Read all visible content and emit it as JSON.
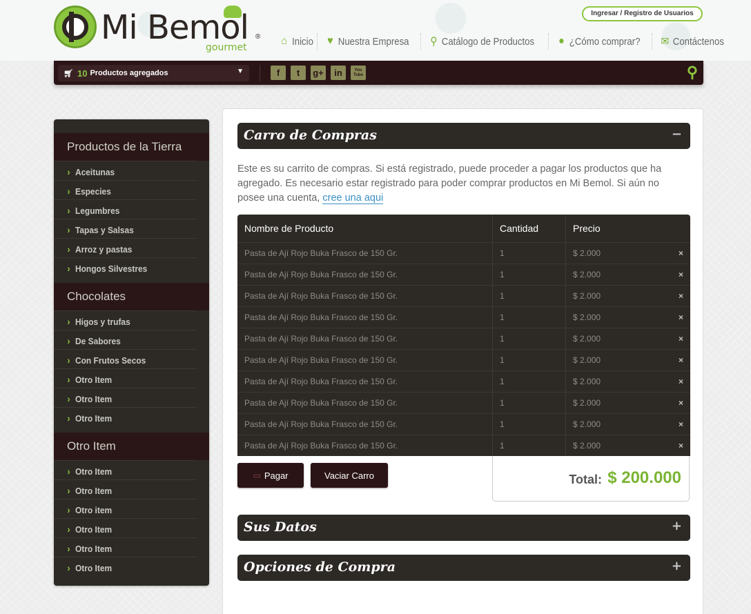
{
  "header": {
    "brand": "Mi Bemol",
    "brand_sub": "gourmet",
    "brand_reg": "®",
    "login_label": "Ingresar / Registro de Usuarios",
    "nav": [
      {
        "label": "Inicio",
        "icon": "home-icon"
      },
      {
        "label": "Nuestra Empresa",
        "icon": "heart-icon"
      },
      {
        "label": "Catálogo de Productos",
        "icon": "search-icon"
      },
      {
        "label": "¿Cómo comprar?",
        "icon": "lightbulb-icon"
      },
      {
        "label": "Contáctenos",
        "icon": "envelope-icon"
      }
    ]
  },
  "toolbar": {
    "cart_count": "10",
    "cart_label": "Productos agregados",
    "social": [
      "f",
      "t",
      "g+",
      "in",
      "You Tube"
    ]
  },
  "sidebar": {
    "categories": [
      {
        "title": "Productos de la Tierra",
        "items": [
          "Aceitunas",
          "Especies",
          "Legumbres",
          "Tapas y Salsas",
          "Arroz y pastas",
          "Hongos Silvestres"
        ]
      },
      {
        "title": "Chocolates",
        "items": [
          "Higos y trufas",
          "De Sabores",
          "Con Frutos Secos",
          "Otro Item",
          "Otro Item",
          "Otro Item"
        ]
      },
      {
        "title": "Otro Item",
        "items": [
          "Otro Item",
          "Otro Item",
          "Otro item",
          "Otro Item",
          "Otro Item",
          "Otro Item"
        ]
      }
    ]
  },
  "cart": {
    "title": "Carro de Compras",
    "toggle": "−",
    "intro_text": "Este es su carrito de compras. Si está registrado, puede proceder a pagar los productos que ha agregado. Es necesario estar registrado para poder comprar productos en Mi Bemol. Si aún no posee una cuenta,",
    "intro_link": "cree una aqui",
    "columns": [
      "Nombre de Producto",
      "Cantidad",
      "Precio"
    ],
    "rows": [
      {
        "name": "Pasta de Ají Rojo Buka Frasco de 150 Gr.",
        "qty": "1",
        "price": "$ 2.000"
      },
      {
        "name": "Pasta de Ají Rojo Buka Frasco de 150 Gr.",
        "qty": "1",
        "price": "$ 2.000"
      },
      {
        "name": "Pasta de Ají Rojo Buka Frasco de 150 Gr.",
        "qty": "1",
        "price": "$ 2.000"
      },
      {
        "name": "Pasta de Ají Rojo Buka Frasco de 150 Gr.",
        "qty": "1",
        "price": "$ 2.000"
      },
      {
        "name": "Pasta de Ají Rojo Buka Frasco de 150 Gr.",
        "qty": "1",
        "price": "$ 2.000"
      },
      {
        "name": "Pasta de Ají Rojo Buka Frasco de 150 Gr.",
        "qty": "1",
        "price": "$ 2.000"
      },
      {
        "name": "Pasta de Ají Rojo Buka Frasco de 150 Gr.",
        "qty": "1",
        "price": "$ 2.000"
      },
      {
        "name": "Pasta de Ají Rojo Buka Frasco de 150 Gr.",
        "qty": "1",
        "price": "$ 2.000"
      },
      {
        "name": "Pasta de Ají Rojo Buka Frasco de 150 Gr.",
        "qty": "1",
        "price": "$ 2.000"
      },
      {
        "name": "Pasta de Ají Rojo Buka Frasco de 150 Gr.",
        "qty": "1",
        "price": "$ 2.000"
      }
    ],
    "remove_symbol": "×",
    "pay_label": "Pagar",
    "empty_label": "Vaciar Carro",
    "total_label": "Total:",
    "total_value": "$ 200.000"
  },
  "panels": [
    {
      "title": "Sus Datos",
      "toggle": "+"
    },
    {
      "title": "Opciones de Compra",
      "toggle": "+"
    }
  ],
  "colors": {
    "accent": "#8cc63f",
    "dark": "#2d2a26",
    "maroon": "#2a1416"
  }
}
